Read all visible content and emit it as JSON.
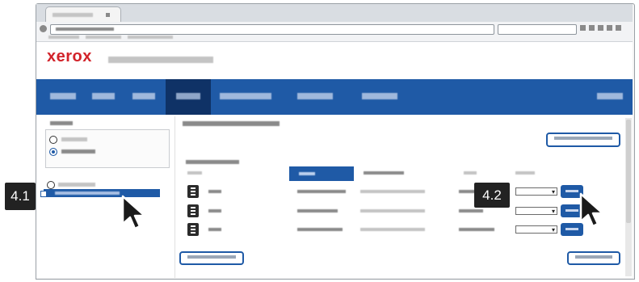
{
  "brand": {
    "logo_text": "xerox"
  },
  "callouts": [
    {
      "label": "4.1"
    },
    {
      "label": "4.2"
    }
  ],
  "rows": [
    {
      "select_value": ""
    },
    {
      "select_value": ""
    },
    {
      "select_value": ""
    }
  ],
  "icons": {
    "pointer": "pointer-cursor-icon",
    "document": "document-icon",
    "radio": "radio-button-icon",
    "chevron": "chevron-down-icon"
  },
  "colors": {
    "nav": "#1f5aa6",
    "nav_selected": "#0f3266",
    "logo": "#d2232a",
    "callout_bg": "#222222"
  }
}
